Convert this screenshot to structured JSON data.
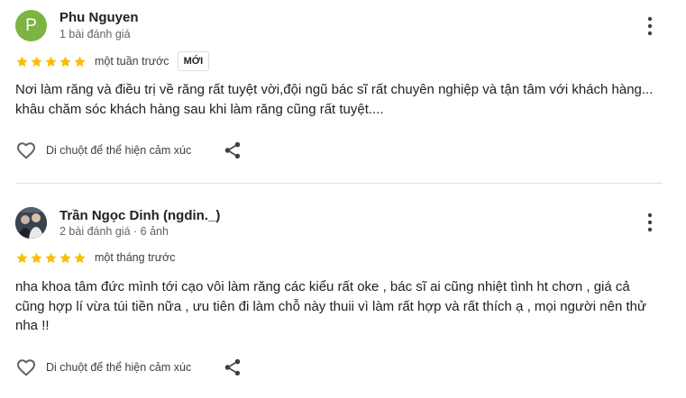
{
  "reviews": [
    {
      "avatar_letter": "P",
      "avatar_color": "#7cb342",
      "name": "Phu Nguyen",
      "meta": "1 bài đánh giá",
      "rating": 5,
      "time": "một tuần trước",
      "badge": "MỚI",
      "text": "Nơi làm răng và điều trị về răng rất tuyệt vời,đội ngũ bác sĩ rất chuyên nghiệp và tận tâm với khách hàng... khâu chăm sóc khách hàng sau khi làm răng cũng rất tuyệt....",
      "react_label": "Di chuột để thể hiện cảm xúc"
    },
    {
      "name": "Trần Ngọc Dinh (ngdin._)",
      "meta": "2 bài đánh giá · 6 ảnh",
      "rating": 5,
      "time": "một tháng trước",
      "text": "nha khoa tâm đức mình tới cạo vôi làm răng các kiểu rất oke , bác sĩ ai cũng nhiệt tình ht chơn , giá cả cũng hợp lí vừa túi tiền nữa , ưu tiên đi làm chỗ này thuii vì làm rất hợp và rất thích ạ , mọi người nên thử nha !!",
      "react_label": "Di chuột để thể hiện cảm xúc"
    }
  ],
  "colors": {
    "star": "#fbbc04",
    "text_secondary": "#5f6368",
    "icon": "#5f6368"
  },
  "icons": [
    "more-vert-icon",
    "star-icon",
    "heart-outline-icon",
    "share-icon"
  ]
}
